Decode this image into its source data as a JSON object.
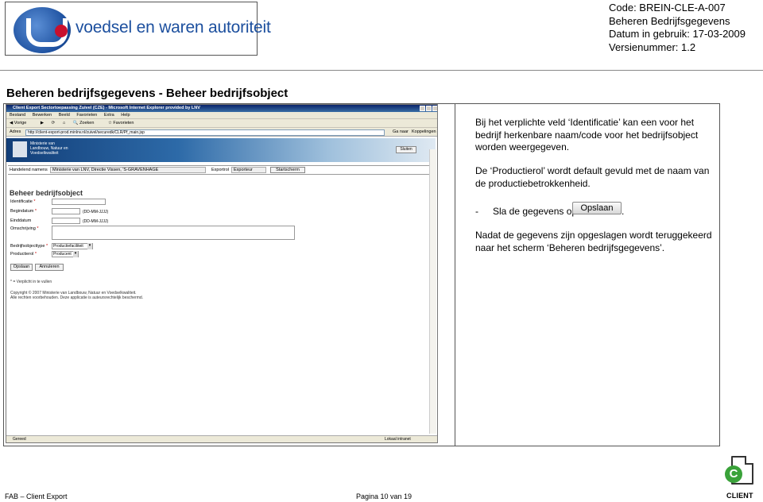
{
  "header": {
    "logo_text": "voedsel en waren autoriteit",
    "code": "Code: BREIN-CLE-A-007",
    "subject": "Beheren Bedrijfsgegevens",
    "date_in_use": "Datum in gebruik: 17-03-2009",
    "version": "Versienummer: 1.2"
  },
  "doc_title": "Beheren bedrijfsgegevens - Beheer bedrijfsobject",
  "screenshot": {
    "window_title": "Client Export Sectortoepassing Zuivel (CZE) - Microsoft Internet Explorer provided by LNV",
    "menu": [
      "Bestand",
      "Bewerken",
      "Beeld",
      "Favorieten",
      "Extra",
      "Help"
    ],
    "toolbar": [
      "Vorige",
      "Zoeken",
      "Favorieten"
    ],
    "address_label": "Adres",
    "address_value": "http://client-export-prod.minlnv.nl/zuivel/securedk/CLR/Pf_main.jsp",
    "go_label": "Ga naar",
    "links_label": "Koppelingen",
    "org_line1": "Ministerie van",
    "org_line2": "Landbouw, Natuur en",
    "org_line3": "Voedselkwaliteit",
    "close_button": "Sluiten",
    "handelend_label": "Handelend namens",
    "handelend_value": "Ministerie van LNV, Directie Vissen, 'S-GRAVENHAGE",
    "exportrol_label": "Exportrol",
    "exportrol_value": "Exporteur",
    "startscherm_button": "Startscherm",
    "form_title": "Beheer bedrijfsobject",
    "fields": {
      "identificatie": "Identificatie",
      "begindatum": "Begindatum",
      "einddatum": "Einddatum",
      "omschrijving": "Omschrijving",
      "bedrijfsobjecttype": "Bedrijfsobjecttype",
      "productierol": "Productierol"
    },
    "date_hint": "(DD-MM-JJJJ)",
    "bedrijfsobjecttype_value": "Productiefaciliteit",
    "productierol_value": "Producent",
    "opslaan_button": "Opslaan",
    "annuleren_button": "Annuleren",
    "required_note": "* = Verplicht in te vullen",
    "copyright_line1": "Copyright © 2007 Ministerie van Landbouw, Natuur en Voedselkwaliteit.",
    "copyright_line2": "Alle rechten voorbehouden. Deze applicatie is auteursrechtelijk beschermd.",
    "status_left": "Gereed",
    "status_right": "Lokaal intranet"
  },
  "instructions": {
    "p1": "Bij het verplichte veld ‘Identificatie’ kan een voor het bedrijf herkenbare naam/code voor het bedrijfsobject worden weergegeven.",
    "p2": "De ‘Productierol’ wordt default gevuld met de naam van de productiebetrokkenheid.",
    "p3_dash": "-",
    "p3_text": "Sla de gegevens op",
    "p3_button": "Opslaan",
    "p3_end": ".",
    "p4": "Nadat de gegevens zijn opgeslagen wordt teruggekeerd naar het scherm ‘Beheren bedrijfsgegevens’."
  },
  "footer": {
    "left": "FAB – Client Export",
    "center": "Pagina 10 van 19",
    "logo_letter": "C",
    "logo_word": "CLIENT"
  },
  "colors": {
    "vwa_blue": "#1c4f9e",
    "client_green": "#3aa23a"
  }
}
